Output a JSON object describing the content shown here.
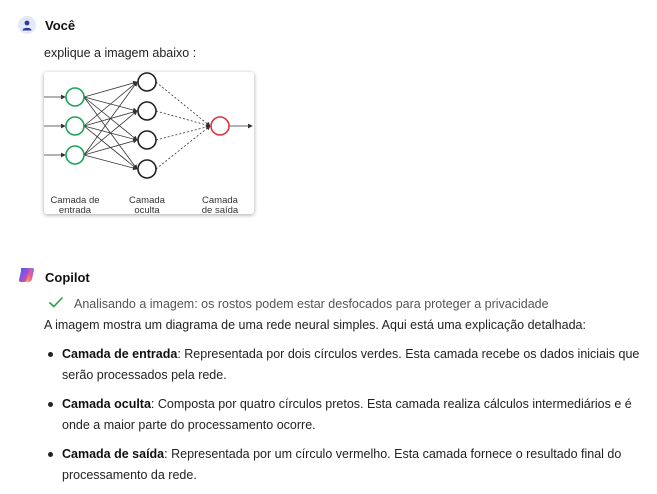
{
  "user_message": {
    "author": "Você",
    "text": "explique a imagem abaixo :",
    "image": {
      "labels": {
        "input": [
          "Camada de",
          "entrada"
        ],
        "hidden": [
          "Camada",
          "oculta"
        ],
        "output": [
          "Camada",
          "de saída"
        ]
      }
    }
  },
  "copilot_message": {
    "author": "Copilot",
    "status": "Analisando a imagem: os rostos podem estar desfocados para proteger a privacidade",
    "intro": "A imagem mostra um diagrama de uma rede neural simples. Aqui está uma explicação detalhada:",
    "bullets": [
      {
        "term": "Camada de entrada",
        "text": ": Representada por dois círculos verdes. Esta camada recebe os dados iniciais que serão processados pela rede."
      },
      {
        "term": "Camada oculta",
        "text": ": Composta por quatro círculos pretos. Esta camada realiza cálculos intermediários e é onde a maior parte do processamento ocorre."
      },
      {
        "term": "Camada de saída",
        "text": ": Representada por um círculo vermelho. Esta camada fornece o resultado final do processamento da rede."
      }
    ]
  },
  "colors": {
    "input_node": "#1fa25a",
    "hidden_node": "#222222",
    "output_node": "#e0313a",
    "check": "#2e9e4a"
  }
}
